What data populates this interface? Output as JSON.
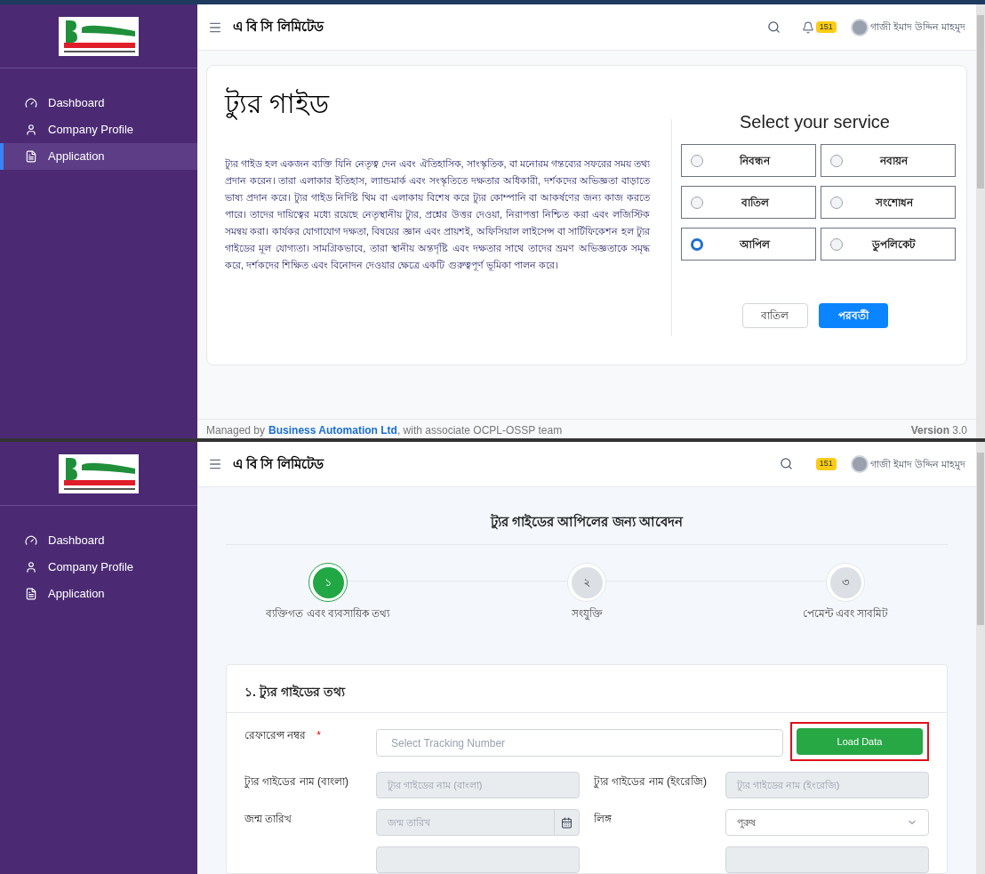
{
  "top_screen": {
    "header": {
      "title": "এ বি সি লিমিটেড",
      "bell": true,
      "badge": "151",
      "user": "গাজী ইমাদ উদ্দিন মাহমুদ"
    },
    "sidebar": [
      {
        "label": "Dashboard",
        "selected": false
      },
      {
        "label": "Company Profile",
        "selected": false
      },
      {
        "label": "Application",
        "selected": true
      }
    ],
    "heading": "ট্যুর গাইড",
    "description": "ট্যুর গাইড হল একজন ব্যক্তি যিনি নেতৃত্ব দেন এবং ঐতিহাসিক, সাংস্কৃতিক, বা মনোরম গন্তব্যের সফরের সময় তথ্য প্রদান করেন। তারা এলাকার ইতিহাস, ল্যান্ডমার্ক এবং সংস্কৃতিতে দক্ষতার অধিকারী, দর্শকদের অভিজ্ঞতা বাড়াতে ভাষ্য প্রদান করে। ট্যুর গাইড নির্দিষ্ট থিম বা এলাকায় বিশেষ করে ট্যুর কোম্পানি বা আকর্ষণের জন্য কাজ করতে পারে। তাদের দায়িত্বের মধ্যে রয়েছে নেতৃস্থানীয় ট্যুর, প্রশ্নের উত্তর দেওয়া, নিরাপত্তা নিশ্চিত করা এবং লজিস্টিক সমন্বয় করা। কার্যকর যোগাযোগ দক্ষতা, বিষয়ের জ্ঞান এবং প্রায়শই, অফিসিয়াল লাইসেন্স বা সার্টিফিকেশন হল ট্যুর গাইডের মূল যোগ্যতা। সামগ্রিকভাবে, তারা স্থানীয় অন্তর্দৃষ্টি এবং দক্ষতার সাথে তাদের ভ্রমণ অভিজ্ঞতাকে সমৃদ্ধ করে, দর্শকদের শিক্ষিত এবং বিনোদন দেওয়ার ক্ষেত্রে একটি গুরুত্বপূর্ণ ভূমিকা পালন করে।",
    "service_title": "Select your service",
    "services": [
      {
        "label": "নিবন্ধন",
        "selected": false
      },
      {
        "label": "নবায়ন",
        "selected": false
      },
      {
        "label": "বাতিল",
        "selected": false
      },
      {
        "label": "সংশোধন",
        "selected": false
      },
      {
        "label": "আপিল",
        "selected": true
      },
      {
        "label": "ডুপলিকেট",
        "selected": false
      }
    ],
    "cancel_button": "বাতিল",
    "next_button": "পরবর্তী",
    "footer": {
      "prefix": "Managed by",
      "link": "Business Automation Ltd",
      "suffix": ", with associate OCPL-OSSP team",
      "version": "**Version** 3.0"
    }
  },
  "bottom_screen": {
    "header": {
      "title": "এ বি সি লিমিটেড",
      "bell": false,
      "badge": "151",
      "user": "গাজী ইমাদ উদ্দিন মাহমুদ"
    },
    "sidebar": [
      {
        "label": "Dashboard",
        "selected": false
      },
      {
        "label": "Company Profile",
        "selected": false
      },
      {
        "label": "Application",
        "selected": false
      }
    ],
    "title": "ট্যুর গাইডের আপিলের জন্য আবেদন",
    "steps": [
      {
        "number": "১",
        "label": "ব্যক্তিগত এবং ব্যবসায়িক তথ্য",
        "selected": true
      },
      {
        "number": "২",
        "label": "সংযুক্তি",
        "selected": false
      },
      {
        "number": "৩",
        "label": "পেমেন্ট এবং সাবমিট",
        "selected": false
      }
    ],
    "section_title": "১. ট্যুর গাইডের তথ্য",
    "reference": {
      "label": "রেফারেন্স নম্বর",
      "required_mark": "*",
      "placeholder": "Select Tracking Number",
      "button": "Load Data",
      "highlighted": true
    },
    "fields": [
      {
        "label": "ট্যুর গাইডের নাম (বাংলা)",
        "placeholder": "ট্যুর গাইডের নাম (বাংলা)",
        "kind": "text"
      },
      {
        "label": "ট্যুর গাইডের নাম (ইংরেজি)",
        "placeholder": "ট্যুর গাইডের নাম (ইংরেজি)",
        "kind": "text"
      },
      {
        "label": "জন্ম তারিখ",
        "placeholder": "জন্ম তারিখ",
        "kind": "date"
      },
      {
        "label": "লিঙ্গ",
        "value": "পুরুষ",
        "kind": "select"
      }
    ]
  }
}
